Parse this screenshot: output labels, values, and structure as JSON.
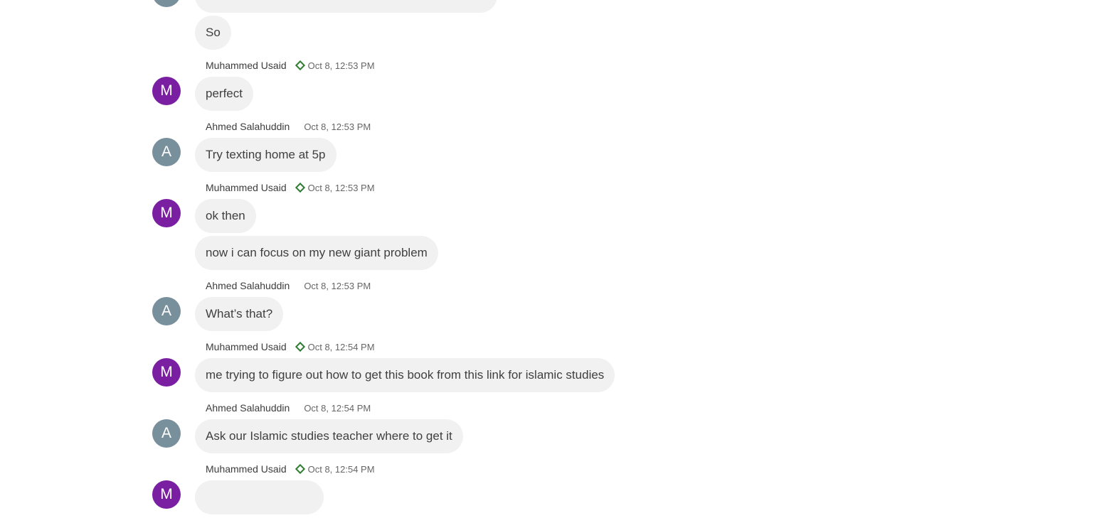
{
  "colors": {
    "M": "#7b1fa2",
    "A": "#78909c",
    "bubble": "#f1f1f1",
    "badge": "#2e7d32"
  },
  "groups": [
    {
      "sender": "",
      "initial": "",
      "avatar": "A",
      "badge": false,
      "time": "",
      "messages": [
        "",
        "So"
      ]
    },
    {
      "sender": "Muhammed Usaid",
      "initial": "M",
      "avatar": "M",
      "badge": true,
      "time": "Oct 8, 12:53 PM",
      "messages": [
        "perfect"
      ]
    },
    {
      "sender": "Ahmed Salahuddin",
      "initial": "A",
      "avatar": "A",
      "badge": false,
      "time": "Oct 8, 12:53 PM",
      "messages": [
        "Try texting home at 5p"
      ]
    },
    {
      "sender": "Muhammed Usaid",
      "initial": "M",
      "avatar": "M",
      "badge": true,
      "time": "Oct 8, 12:53 PM",
      "messages": [
        "ok then",
        "now i can focus on my new giant problem"
      ]
    },
    {
      "sender": "Ahmed Salahuddin",
      "initial": "A",
      "avatar": "A",
      "badge": false,
      "time": "Oct 8, 12:53 PM",
      "messages": [
        "What’s that?"
      ]
    },
    {
      "sender": "Muhammed Usaid",
      "initial": "M",
      "avatar": "M",
      "badge": true,
      "time": "Oct 8, 12:54 PM",
      "messages": [
        "me trying to figure out how to get this book from this link for islamic studies"
      ]
    },
    {
      "sender": "Ahmed Salahuddin",
      "initial": "A",
      "avatar": "A",
      "badge": false,
      "time": "Oct 8, 12:54 PM",
      "messages": [
        "Ask our Islamic studies teacher where to get it"
      ]
    },
    {
      "sender": "Muhammed Usaid",
      "initial": "M",
      "avatar": "M",
      "badge": true,
      "time": "Oct 8, 12:54 PM",
      "messages": [
        ""
      ]
    }
  ]
}
